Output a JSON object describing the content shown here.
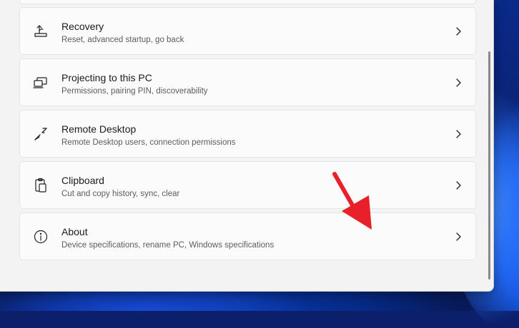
{
  "settings": {
    "items": [
      {
        "title": "Recovery",
        "subtitle": "Reset, advanced startup, go back",
        "icon": "recovery-icon"
      },
      {
        "title": "Projecting to this PC",
        "subtitle": "Permissions, pairing PIN, discoverability",
        "icon": "projecting-icon"
      },
      {
        "title": "Remote Desktop",
        "subtitle": "Remote Desktop users, connection permissions",
        "icon": "remote-desktop-icon"
      },
      {
        "title": "Clipboard",
        "subtitle": "Cut and copy history, sync, clear",
        "icon": "clipboard-icon"
      },
      {
        "title": "About",
        "subtitle": "Device specifications, rename PC, Windows specifications",
        "icon": "info-icon"
      }
    ]
  },
  "colors": {
    "window_background": "#f3f3f3",
    "card_background": "#fbfbfb",
    "card_border": "#e5e5e5",
    "annotation_arrow": "#e8202a",
    "wallpaper": "#0a2a8a"
  }
}
